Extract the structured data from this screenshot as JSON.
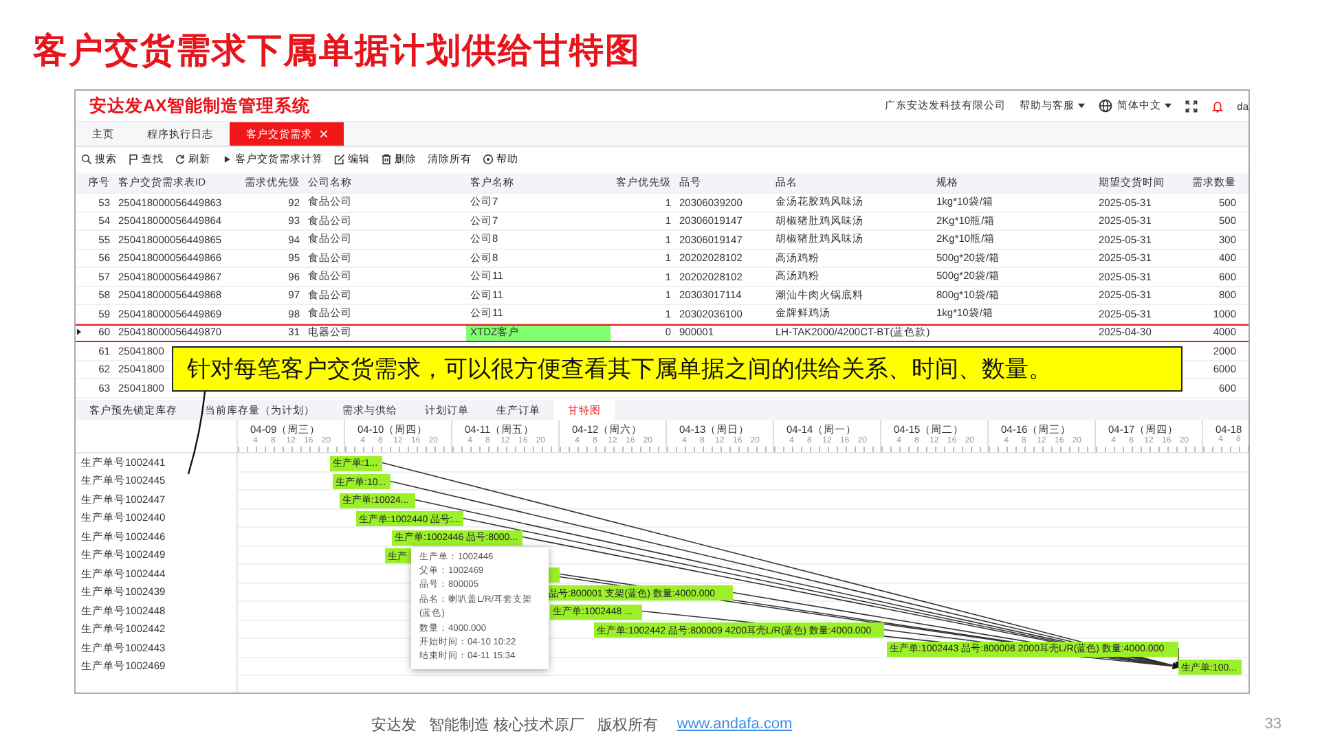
{
  "slide_title": "客户交货需求下属单据计划供给甘特图",
  "app": {
    "title": "安达发AX智能制造管理系统",
    "company": "广东安达发科技有限公司",
    "help": "帮助与客服",
    "language": "简体中文",
    "user": "da"
  },
  "tabs": [
    {
      "label": "主页",
      "selected": false,
      "closable": false
    },
    {
      "label": "程序执行日志",
      "selected": false,
      "closable": false
    },
    {
      "label": "客户交货需求",
      "selected": true,
      "closable": true
    }
  ],
  "toolbar": [
    {
      "label": "搜索",
      "kind": "search"
    },
    {
      "label": "查找",
      "kind": "flag"
    },
    {
      "label": "刷新",
      "kind": "refresh"
    },
    {
      "label": "客户交货需求计算",
      "kind": "play"
    },
    {
      "label": "编辑",
      "kind": "edit"
    },
    {
      "label": "删除",
      "kind": "delete"
    },
    {
      "label": "清除所有",
      "kind": "none"
    },
    {
      "label": "帮助",
      "kind": "help"
    }
  ],
  "table": {
    "columns": [
      "序号",
      "客户交货需求表ID",
      "需求优先级",
      "公司名称",
      "客户名称",
      "客户优先级",
      "品号",
      "品名",
      "规格",
      "期望交货时间",
      "需求数量"
    ],
    "rows": [
      {
        "selected": false,
        "cells": [
          "53",
          "250418000056449863",
          "92",
          "食品公司",
          "公司7",
          "1",
          "20306039200",
          "金汤花胶鸡风味汤",
          "1kg*10袋/箱",
          "2025-05-31",
          "500"
        ]
      },
      {
        "selected": false,
        "cells": [
          "54",
          "250418000056449864",
          "93",
          "食品公司",
          "公司7",
          "1",
          "20306019147",
          "胡椒猪肚鸡风味汤",
          "2Kg*10瓶/箱",
          "2025-05-31",
          "500"
        ]
      },
      {
        "selected": false,
        "cells": [
          "55",
          "250418000056449865",
          "94",
          "食品公司",
          "公司8",
          "1",
          "20306019147",
          "胡椒猪肚鸡风味汤",
          "2Kg*10瓶/箱",
          "2025-05-31",
          "300"
        ]
      },
      {
        "selected": false,
        "cells": [
          "56",
          "250418000056449866",
          "95",
          "食品公司",
          "公司8",
          "1",
          "20202028102",
          "高汤鸡粉",
          "500g*20袋/箱",
          "2025-05-31",
          "400"
        ]
      },
      {
        "selected": false,
        "cells": [
          "57",
          "250418000056449867",
          "96",
          "食品公司",
          "公司11",
          "1",
          "20202028102",
          "高汤鸡粉",
          "500g*20袋/箱",
          "2025-05-31",
          "600"
        ]
      },
      {
        "selected": false,
        "cells": [
          "58",
          "250418000056449868",
          "97",
          "食品公司",
          "公司11",
          "1",
          "20303017114",
          "潮汕牛肉火锅底料",
          "800g*10袋/箱",
          "2025-05-31",
          "800"
        ]
      },
      {
        "selected": false,
        "cells": [
          "59",
          "250418000056449869",
          "98",
          "食品公司",
          "公司11",
          "1",
          "20302036100",
          "金牌鲜鸡汤",
          "1kg*10袋/箱",
          "2025-05-31",
          "1000"
        ]
      },
      {
        "selected": true,
        "color": "#80ff70",
        "cells": [
          "60",
          "250418000056449870",
          "31",
          "电器公司",
          "XTDZ客户",
          "0",
          "900001",
          "LH-TAK2000/4200CT-BT(蓝色款)",
          null,
          "2025-04-30",
          "4000"
        ]
      },
      {
        "selected": false,
        "cells": [
          "61",
          "25041800",
          null,
          null,
          null,
          null,
          null,
          null,
          null,
          null,
          "2000"
        ]
      },
      {
        "selected": false,
        "cells": [
          "62",
          "25041800",
          null,
          null,
          null,
          null,
          null,
          null,
          null,
          null,
          "6000"
        ]
      },
      {
        "selected": false,
        "cells": [
          "63",
          "25041800",
          null,
          null,
          null,
          null,
          null,
          null,
          null,
          null,
          "600"
        ]
      }
    ]
  },
  "callout": "针对每笔客户交货需求，可以很方便查看其下属单据之间的供给关系、时间、数量。",
  "detail_tabs": [
    {
      "label": "客户预先锁定库存",
      "selected": false
    },
    {
      "label": "当前库存量（为计划）",
      "selected": false
    },
    {
      "label": "需求与供给",
      "selected": false
    },
    {
      "label": "计划订单",
      "selected": false
    },
    {
      "label": "生产订单",
      "selected": false
    },
    {
      "label": "甘特图",
      "selected": true
    }
  ],
  "gantt": {
    "days": [
      {
        "date": "04-09",
        "weekday": "（周三）",
        "hours": [
          "4",
          "8",
          "12",
          "16",
          "20"
        ]
      },
      {
        "date": "04-10",
        "weekday": "（周四）",
        "hours": [
          "4",
          "8",
          "12",
          "16",
          "20"
        ]
      },
      {
        "date": "04-11",
        "weekday": "（周五）",
        "hours": [
          "4",
          "8",
          "12",
          "16",
          "20"
        ]
      },
      {
        "date": "04-12",
        "weekday": "（周六）",
        "hours": [
          "4",
          "8",
          "12",
          "16",
          "20"
        ]
      },
      {
        "date": "04-13",
        "weekday": "（周日）",
        "hours": [
          "4",
          "8",
          "12",
          "16",
          "20"
        ]
      },
      {
        "date": "04-14",
        "weekday": "（周一）",
        "hours": [
          "4",
          "8",
          "12",
          "16",
          "20"
        ]
      },
      {
        "date": "04-15",
        "weekday": "（周二）",
        "hours": [
          "4",
          "8",
          "12",
          "16",
          "20"
        ]
      },
      {
        "date": "04-16",
        "weekday": "（周三）",
        "hours": [
          "4",
          "8",
          "12",
          "16",
          "20"
        ]
      },
      {
        "date": "04-17",
        "weekday": "（周四）",
        "hours": [
          "4",
          "8",
          "12",
          "16",
          "20"
        ]
      },
      {
        "date": "04-18",
        "hours": [
          "4",
          "8"
        ]
      }
    ],
    "rows": [
      {
        "label": "生产单号1002441",
        "bar": "生产单:1..."
      },
      {
        "label": "生产单号1002445",
        "bar": "生产单:10..."
      },
      {
        "label": "生产单号1002447",
        "bar": "生产单:10024..."
      },
      {
        "label": "生产单号1002440",
        "bar": "生产单:1002440 品号:..."
      },
      {
        "label": "生产单号1002446",
        "bar": "生产单:1002446 品号:8000...",
        "tooltip": [
          "生产单：1002446",
          "父单：1002469",
          "品号：800005",
          "品名：喇叭盖L/R/耳套支架(蓝色)",
          "数量：4000.000",
          "开始时间：04-10 10:22",
          "结束时间：04-11 15:34"
        ]
      },
      {
        "label": "生产单号1002449",
        "bar": "生产"
      },
      {
        "label": "生产单号1002444"
      },
      {
        "label": "生产单号1002439",
        "bar": "品号:800001 支架(蓝色) 数量:4000.000"
      },
      {
        "label": "生产单号1002448",
        "bar": "生产单:1002448 ..."
      },
      {
        "label": "生产单号1002442",
        "bar": "生产单:1002442 品号:800009 4200耳壳L/R(蓝色) 数量:4000.000"
      },
      {
        "label": "生产单号1002443",
        "bar": "生产单:1002443 品号:800008 2000耳壳L/R(蓝色) 数量:4000.000"
      },
      {
        "label": "生产单号1002469",
        "bar": "生产单:100..."
      }
    ]
  },
  "footer": {
    "text": "安达发   智能制造 核心技术原厂   版权所有",
    "link": "www.andafa.com",
    "page": "33"
  }
}
